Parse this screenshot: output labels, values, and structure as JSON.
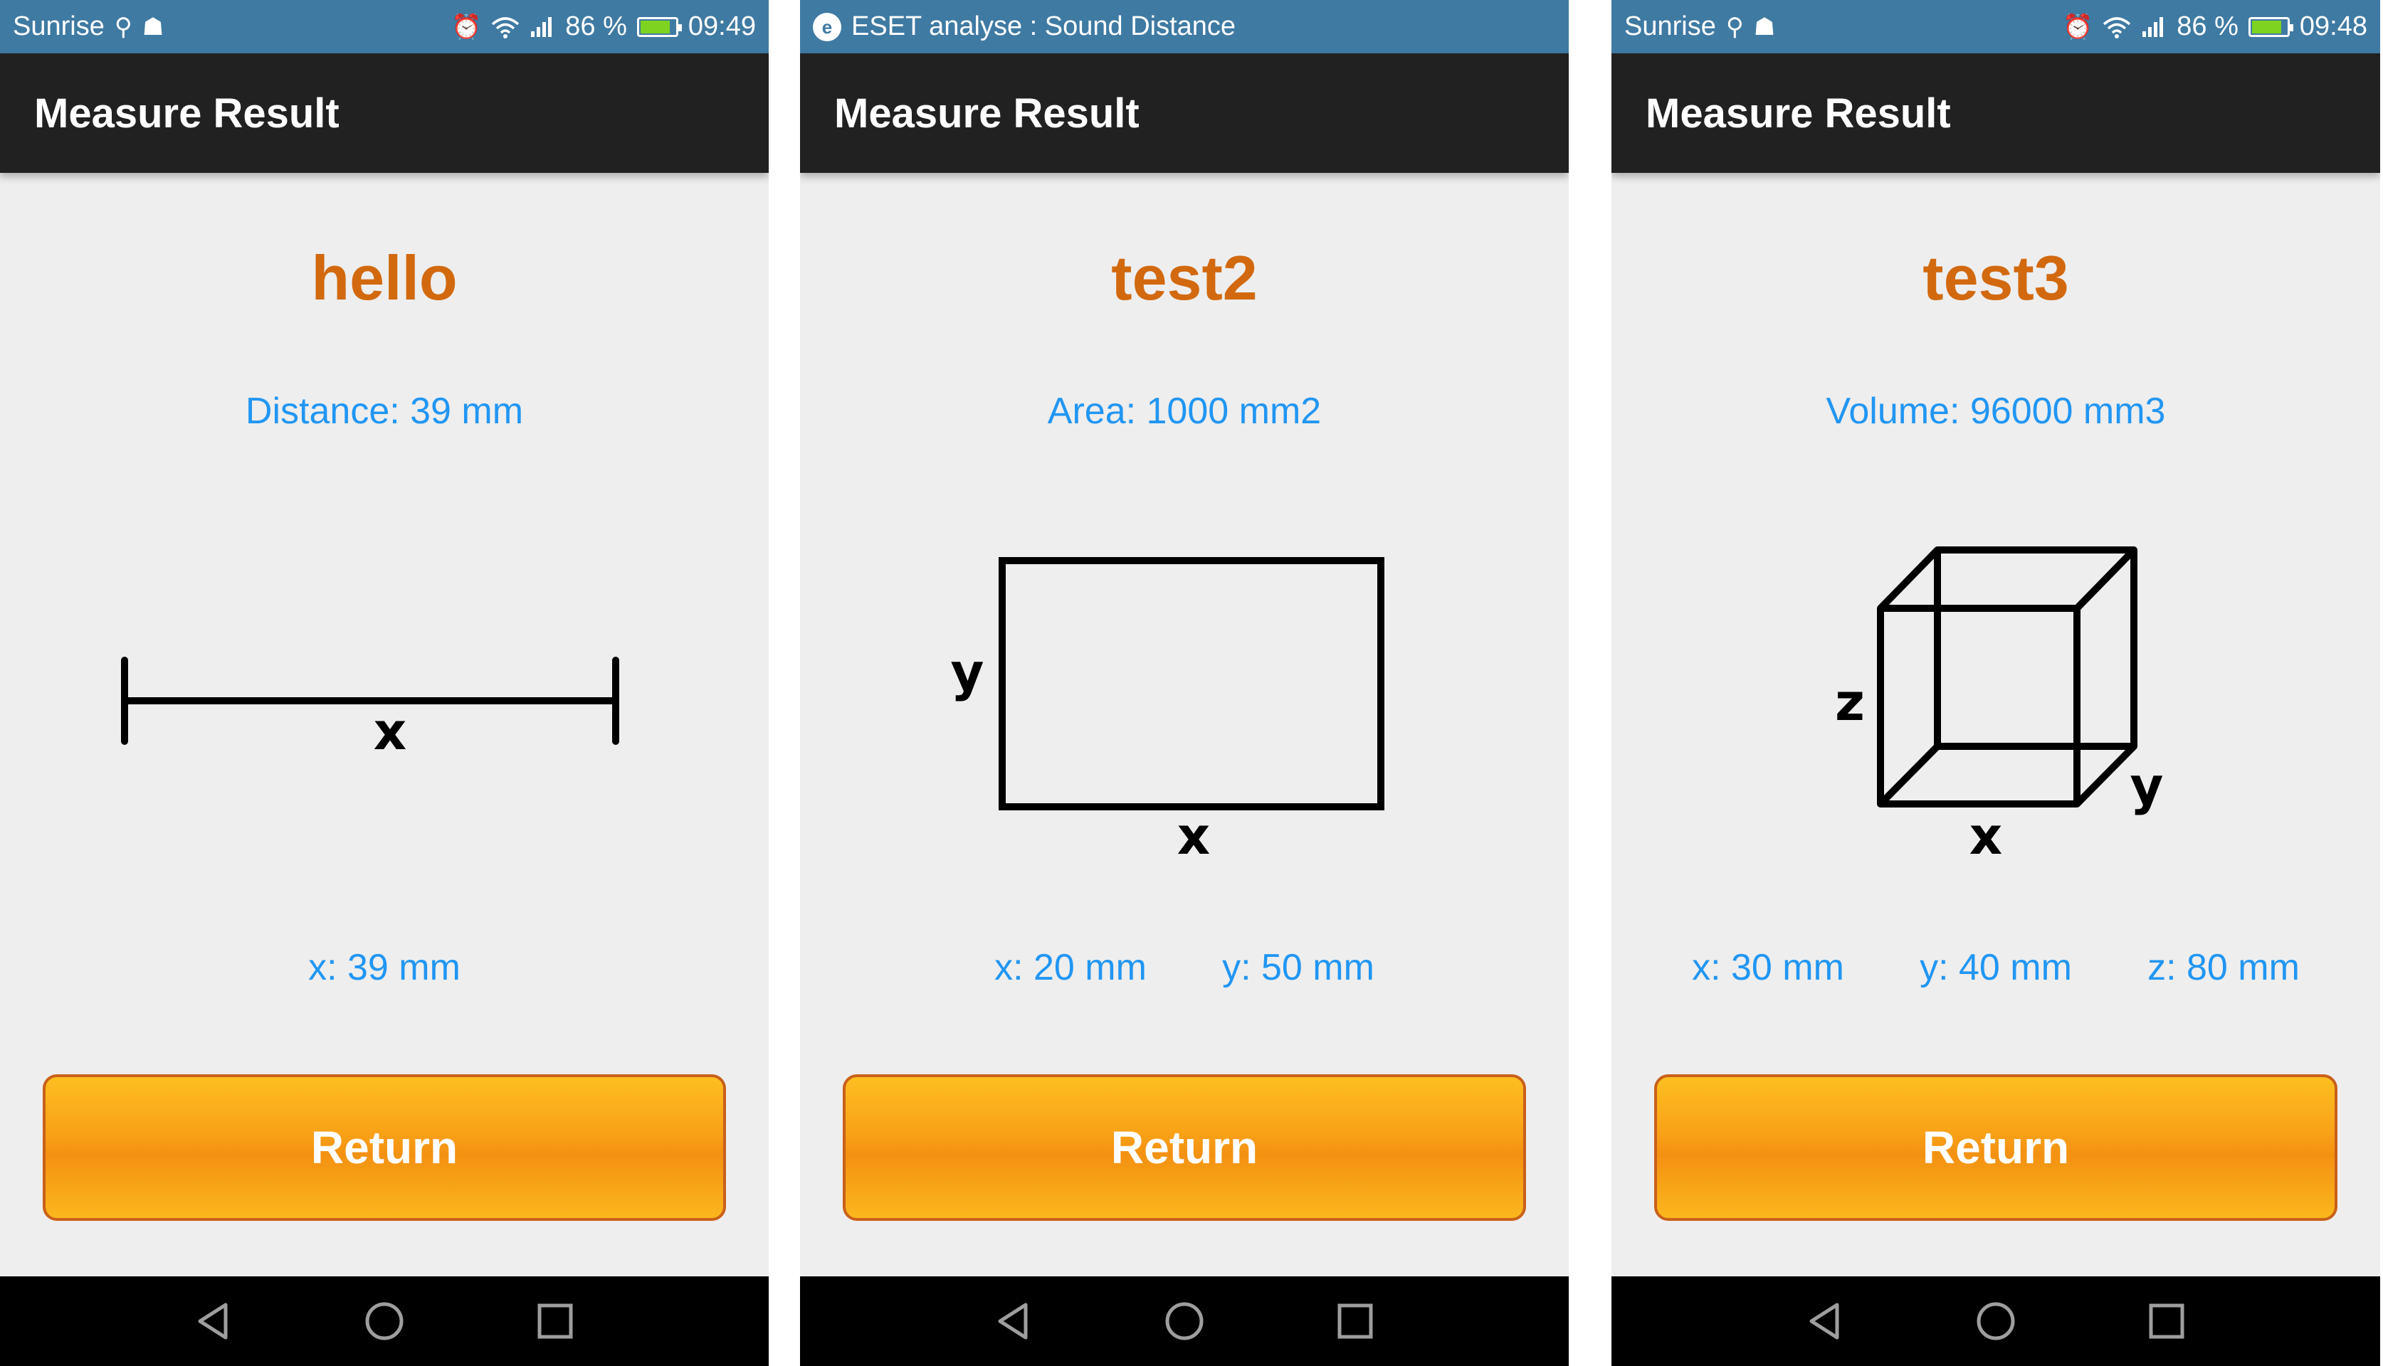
{
  "screens": [
    {
      "status": {
        "left_text": "Sunrise",
        "battery_pct": "86 %",
        "battery_level": 0.86,
        "time": "09:49"
      },
      "appbar_title": "Measure Result",
      "title": "hello",
      "summary": "Distance: 39 mm",
      "figure": {
        "type": "line",
        "labels": {
          "x": "x"
        }
      },
      "dims": [
        "x: 39 mm"
      ],
      "return_label": "Return"
    },
    {
      "status": {
        "notification_text": "ESET analyse : Sound Distance"
      },
      "appbar_title": "Measure Result",
      "title": "test2",
      "summary": "Area: 1000 mm2",
      "figure": {
        "type": "rectangle",
        "labels": {
          "x": "x",
          "y": "y"
        }
      },
      "dims": [
        "x: 20 mm",
        "y: 50 mm"
      ],
      "return_label": "Return"
    },
    {
      "status": {
        "left_text": "Sunrise",
        "battery_pct": "86 %",
        "battery_level": 0.86,
        "time": "09:48"
      },
      "appbar_title": "Measure Result",
      "title": "test3",
      "summary": "Volume: 96000 mm3",
      "figure": {
        "type": "cube",
        "labels": {
          "x": "x",
          "y": "y",
          "z": "z"
        }
      },
      "dims": [
        "x: 30 mm",
        "y: 40 mm",
        "z: 80 mm"
      ],
      "return_label": "Return"
    }
  ],
  "icons": {
    "usb": "usb-icon",
    "android": "android-debug-icon",
    "alarm": "alarm-icon",
    "wifi": "wifi-icon",
    "signal": "signal-icon",
    "battery": "battery-charging-icon",
    "eset": "eset-notification-icon",
    "back": "back-icon",
    "home": "home-icon",
    "recents": "recents-icon"
  },
  "colors": {
    "status_bar": "#3f7aa3",
    "app_bar": "#212121",
    "background": "#eeeeee",
    "title": "#d2690f",
    "info_text": "#2196f3",
    "button_gradient_top": "#fdbf21",
    "button_gradient_mid": "#f39112",
    "button_border": "#c9601a",
    "nav_bar": "#000000"
  }
}
